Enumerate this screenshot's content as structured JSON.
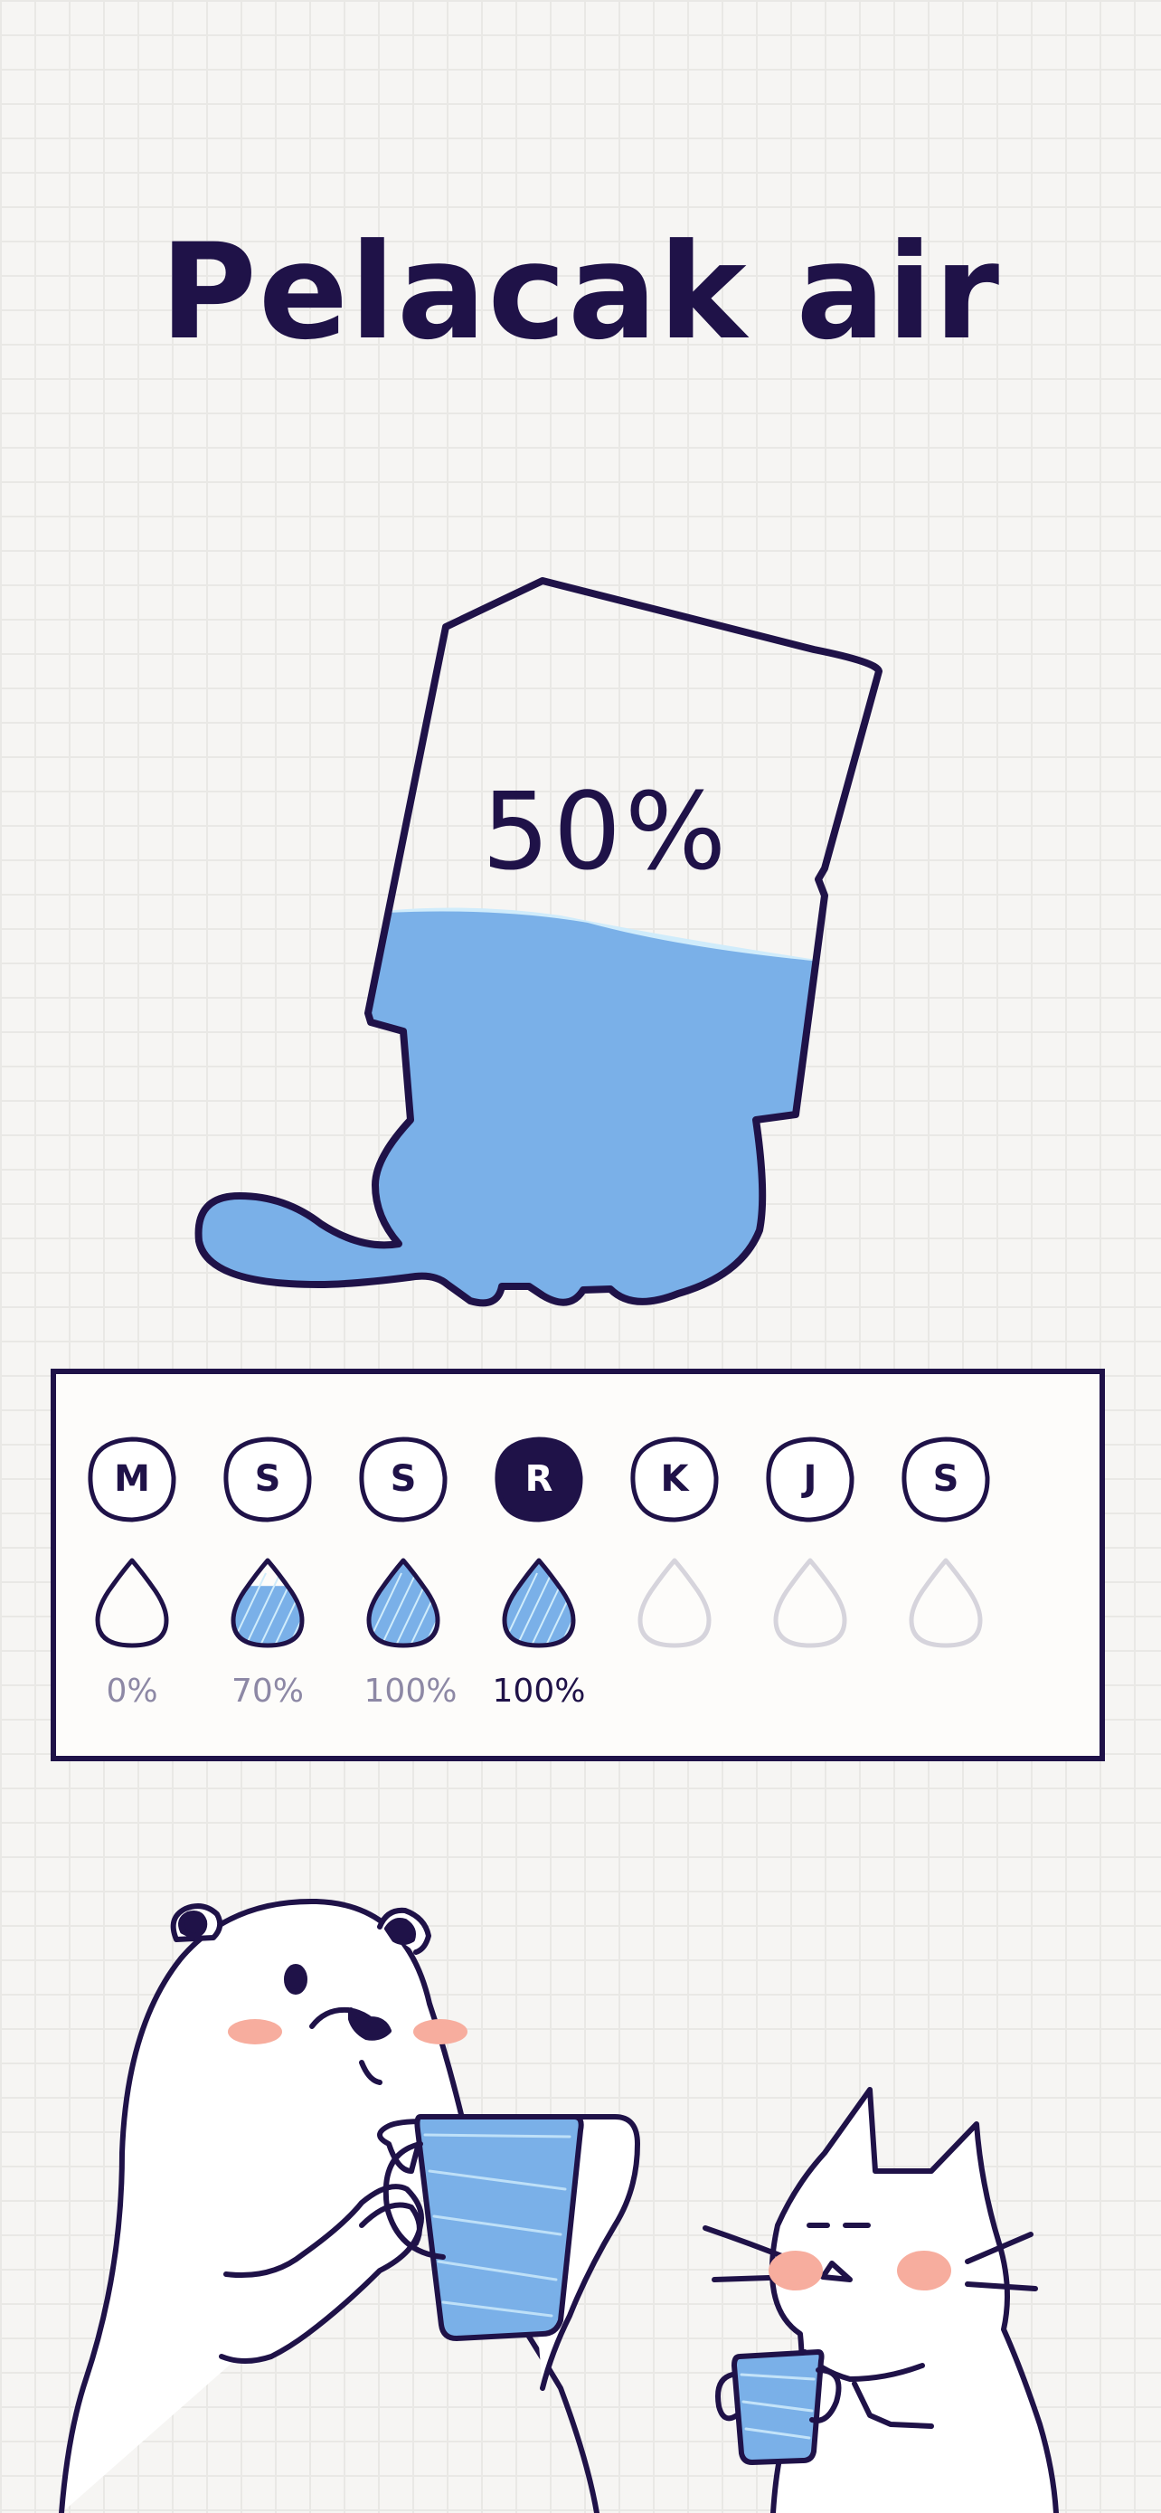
{
  "app": {
    "title": "Pelacak air"
  },
  "today": {
    "percent_label": "50%",
    "fill_fraction": 0.5
  },
  "week": {
    "days": [
      {
        "label": "M",
        "active": false,
        "percent_label": "0%",
        "fill": 0.0,
        "future": false
      },
      {
        "label": "S",
        "active": false,
        "percent_label": "70%",
        "fill": 0.7,
        "future": false
      },
      {
        "label": "S",
        "active": false,
        "percent_label": "100%",
        "fill": 1.0,
        "future": false
      },
      {
        "label": "R",
        "active": true,
        "percent_label": "100%",
        "fill": 1.0,
        "future": false
      },
      {
        "label": "K",
        "active": false,
        "percent_label": "",
        "fill": 0.0,
        "future": true
      },
      {
        "label": "J",
        "active": false,
        "percent_label": "",
        "fill": 0.0,
        "future": true
      },
      {
        "label": "S",
        "active": false,
        "percent_label": "",
        "fill": 0.0,
        "future": true
      }
    ]
  },
  "colors": {
    "ink": "#1f1248",
    "water": "#7ab0e8",
    "water_light": "#d0ecfb",
    "blush": "#f7ad9e",
    "muted": "#8d88a5",
    "future_drop": "#d6d4dc"
  }
}
